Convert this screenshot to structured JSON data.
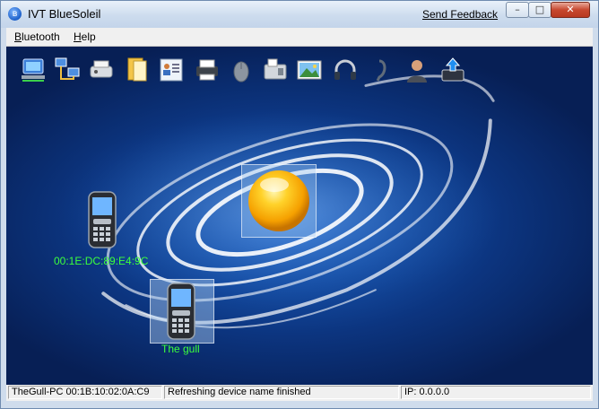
{
  "window": {
    "title": "IVT BlueSoleil",
    "feedback_link": "Send Feedback",
    "minimize_glyph": "–",
    "maximize_glyph": "□",
    "close_glyph": "✕"
  },
  "menu": {
    "items": [
      {
        "label_first": "B",
        "label_rest": "luetooth"
      },
      {
        "label_first": "H",
        "label_rest": "elp"
      }
    ]
  },
  "toolbar": {
    "icons": [
      "network-access-icon",
      "lan-icon",
      "dialup-icon",
      "file-transfer-icon",
      "contacts-icon",
      "printer-icon",
      "mouse-icon",
      "fax-icon",
      "picture-icon",
      "headphones-icon",
      "headset-icon",
      "personal-area-icon",
      "sync-icon"
    ]
  },
  "devices": {
    "local_device": "local-adapter-sphere",
    "phone_1_name": "00:1E:DC:89:E4:9C",
    "phone_2_name": "The gull"
  },
  "status": {
    "local": "TheGull-PC 00:1B:10:02:0A:C9",
    "message": "Refreshing device name finished",
    "ip": "IP: 0.0.0.0"
  },
  "colors": {
    "device_label": "#3cff3c",
    "canvas_center": "#2a6fd0",
    "canvas_edge": "#071f55"
  }
}
